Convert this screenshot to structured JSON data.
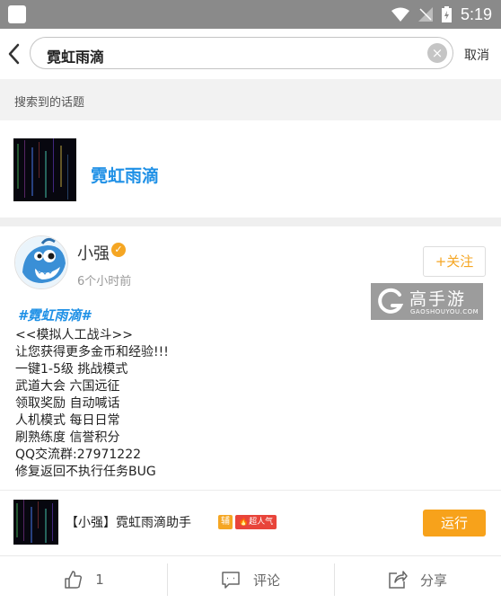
{
  "status_bar": {
    "time": "5:19"
  },
  "search": {
    "query": "霓虹雨滴",
    "cancel_label": "取消"
  },
  "topics": {
    "section_title": "搜索到的话题",
    "items": [
      {
        "name": "霓虹雨滴"
      }
    ]
  },
  "post": {
    "author": "小强",
    "time_ago": "6个小时前",
    "follow_label": "+关注",
    "watermark": {
      "title": "高手游",
      "subtitle": "GAOSHOUYOU.COM"
    },
    "hashtag": "#霓虹雨滴#",
    "lines": [
      "<<模拟人工战斗>>",
      "让您获得更多金币和经验!!!",
      "一键1-5级 挑战模式",
      "武道大会 六国远征",
      "领取奖励 自动喊话",
      "人机模式 每日日常",
      "刷熟练度 信誉积分",
      "QQ交流群:27971222",
      "修复返回不执行任务BUG"
    ]
  },
  "game": {
    "title": "【小强】霓虹雨滴助手",
    "tag_assist": "辅",
    "tag_hot": "超人气",
    "run_label": "运行"
  },
  "actions": {
    "like_count": "1",
    "comment_label": "评论",
    "share_label": "分享"
  },
  "colors": {
    "accent": "#f7a21b",
    "link": "#1e90e6",
    "hot": "#e8443a"
  }
}
